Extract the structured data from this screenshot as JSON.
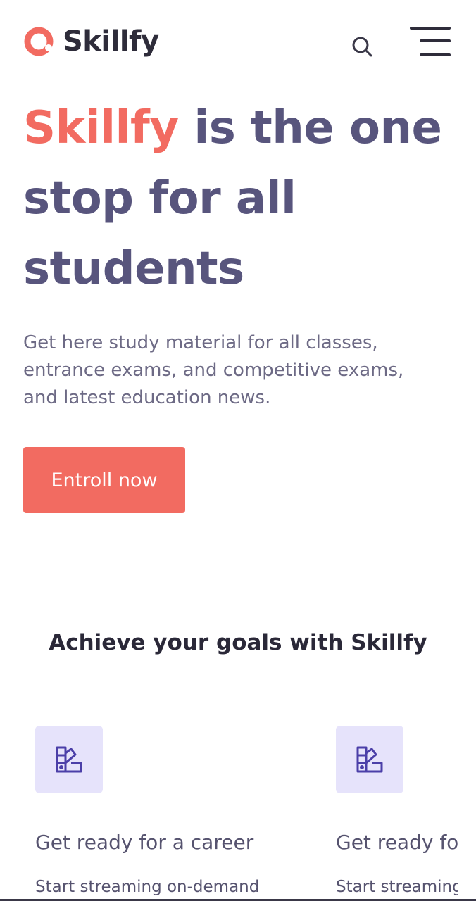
{
  "header": {
    "brand": "Skillfy",
    "icons": {
      "search": "search-icon",
      "menu": "hamburger-menu-icon",
      "logo": "ring-logo-icon"
    }
  },
  "hero": {
    "title_accent": "Skillfy",
    "title_rest": " is the one stop for all students",
    "subtitle": "Get here study material for all classes, entrance exams, and competitive exams, and latest education news.",
    "cta_label": "Entroll now"
  },
  "goals": {
    "heading": "Achieve your goals with Skillfy",
    "cards": [
      {
        "icon": "swatch-book-icon",
        "title": "Get ready for a career",
        "text": "Start streaming on-demand"
      },
      {
        "icon": "swatch-book-icon",
        "title": "Get ready for a career",
        "text": "Start streaming on-demand"
      }
    ]
  },
  "colors": {
    "accent": "#f26b61",
    "heading": "#58557d",
    "dark": "#2e2c3a",
    "icon_bg": "#e6e3fb",
    "icon_fg": "#4b3fa8"
  }
}
